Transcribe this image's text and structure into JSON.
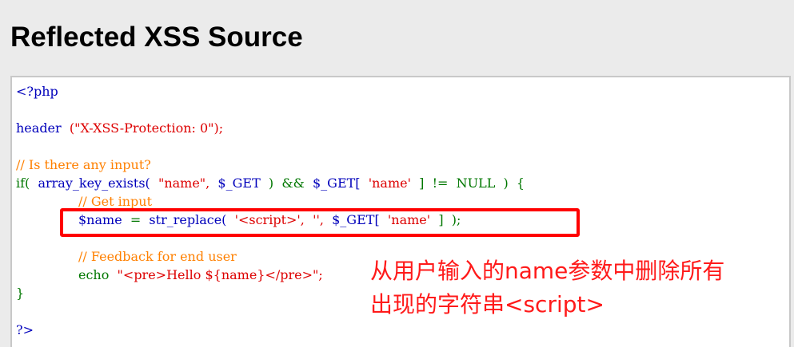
{
  "page": {
    "title": "Reflected XSS Source"
  },
  "code": {
    "line1": "<?php",
    "line3_fn": "header",
    "line3_args": "(\"X-XSS-Protection: 0\");",
    "line5": "// Is there any input?",
    "line6_if": "if(",
    "line6_fn": "array_key_exists(",
    "line6_arg1": "\"name\",",
    "line6_arg2": "$_GET",
    "line6_rest1": ")  &&",
    "line6_get": "$_GET[",
    "line6_key": "'name'",
    "line6_rest2": "]  !=  NULL  )  {",
    "line7": "// Get input",
    "line8_var": "$name",
    "line8_eq": "=",
    "line8_fn": "str_replace(",
    "line8_str1": "'<script>',",
    "line8_str2": "'',",
    "line8_get": "$_GET[",
    "line8_key": "'name'",
    "line8_end": "]  );",
    "line10": "// Feedback for end user",
    "line11_echo": "echo",
    "line11_str": "\"<pre>Hello ${name}</pre>\";",
    "line12": "}",
    "line14": "?>"
  },
  "annotation": {
    "line1": "从用户输入的name参数中删除所有",
    "line2": "出现的字符串<script>"
  },
  "colors": {
    "keyword": "#0000bb",
    "string": "#dd0000",
    "comment": "#ff8000",
    "operator": "#007700",
    "highlight_border": "#ff0000",
    "annotation_text": "#ff1a1a"
  }
}
